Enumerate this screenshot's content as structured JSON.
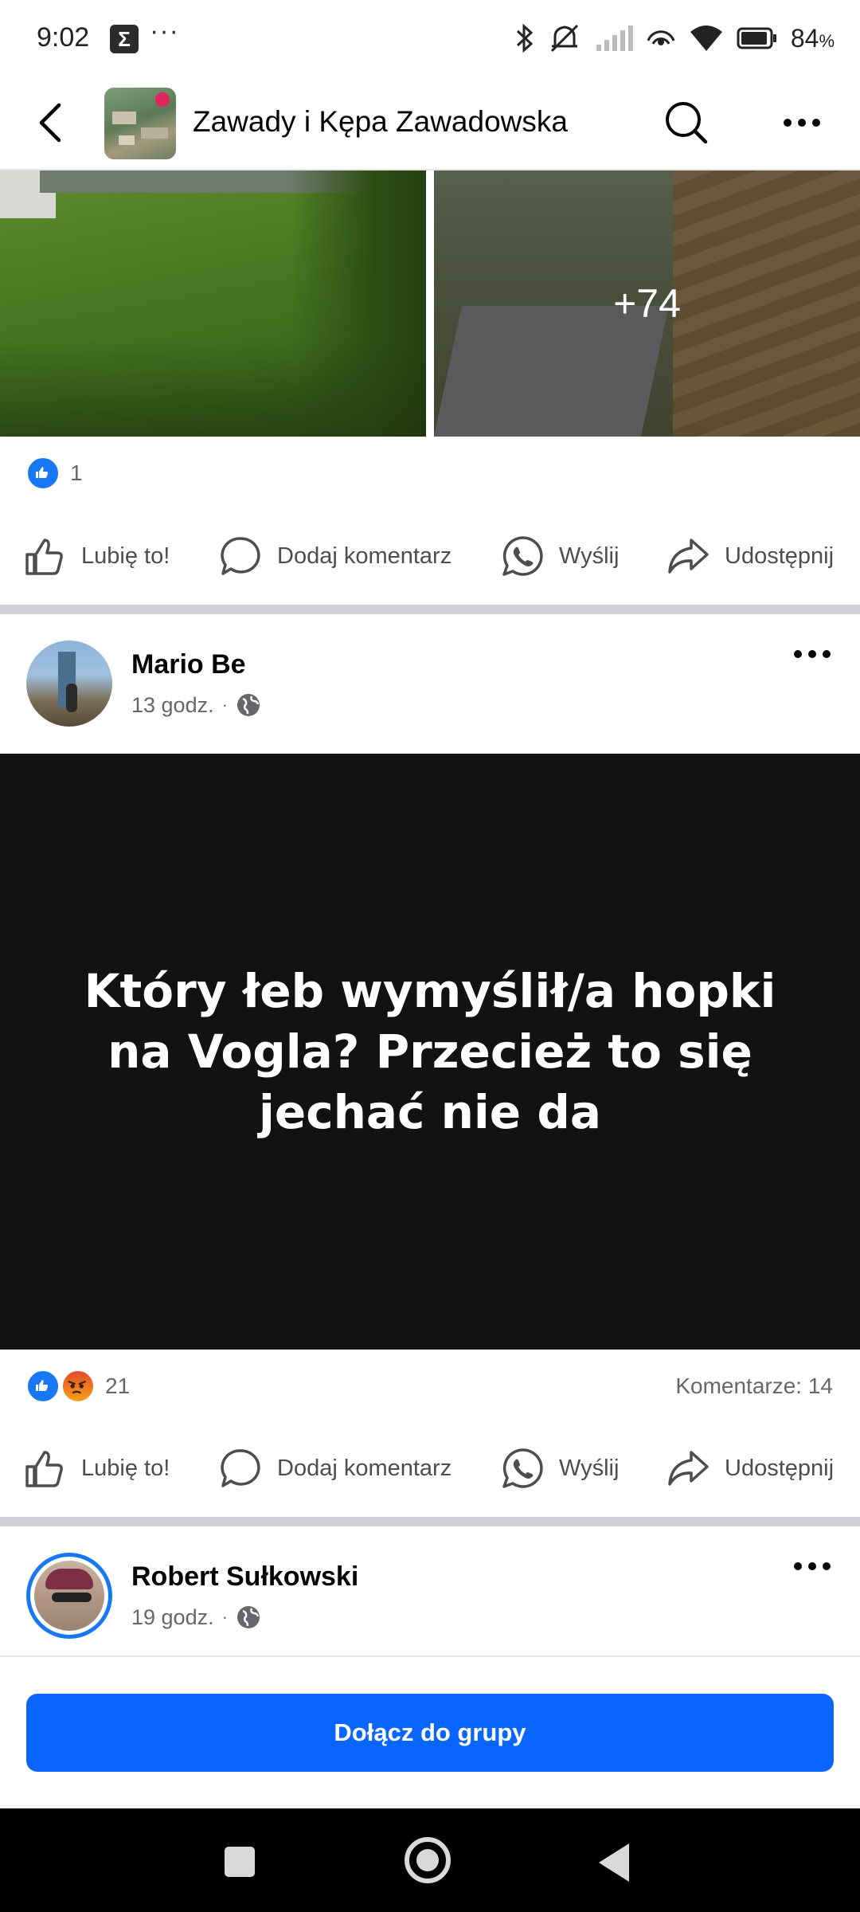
{
  "status_bar": {
    "time": "9:02",
    "sigma": "Σ",
    "dots": "···",
    "battery": "84",
    "battery_unit": "%"
  },
  "header": {
    "title": "Zawady i Kępa Zawadowska",
    "icons": [
      "back-icon",
      "search-icon",
      "more-icon"
    ]
  },
  "post1": {
    "more_photos": "+74",
    "reaction_count": "1"
  },
  "actions": {
    "like": "Lubię to!",
    "comment": "Dodaj komentarz",
    "send": "Wyślij",
    "share": "Udostępnij"
  },
  "post2": {
    "author": "Mario Be",
    "time": "13 godz.",
    "separator": "·",
    "text": "Który łeb wymyślił/a hopki na Vogla? Przecież to się jechać nie da",
    "reaction_count": "21",
    "comments": "Komentarze: 14"
  },
  "post3": {
    "author": "Robert Sułkowski",
    "time": "19 godz.",
    "separator": "·"
  },
  "join": {
    "label": "Dołącz do grupy"
  },
  "colors": {
    "accent": "#0866ff",
    "like_blue": "#1877f2",
    "text_dark": "#050505",
    "text_muted": "#65676b",
    "post_background": "#121212"
  }
}
